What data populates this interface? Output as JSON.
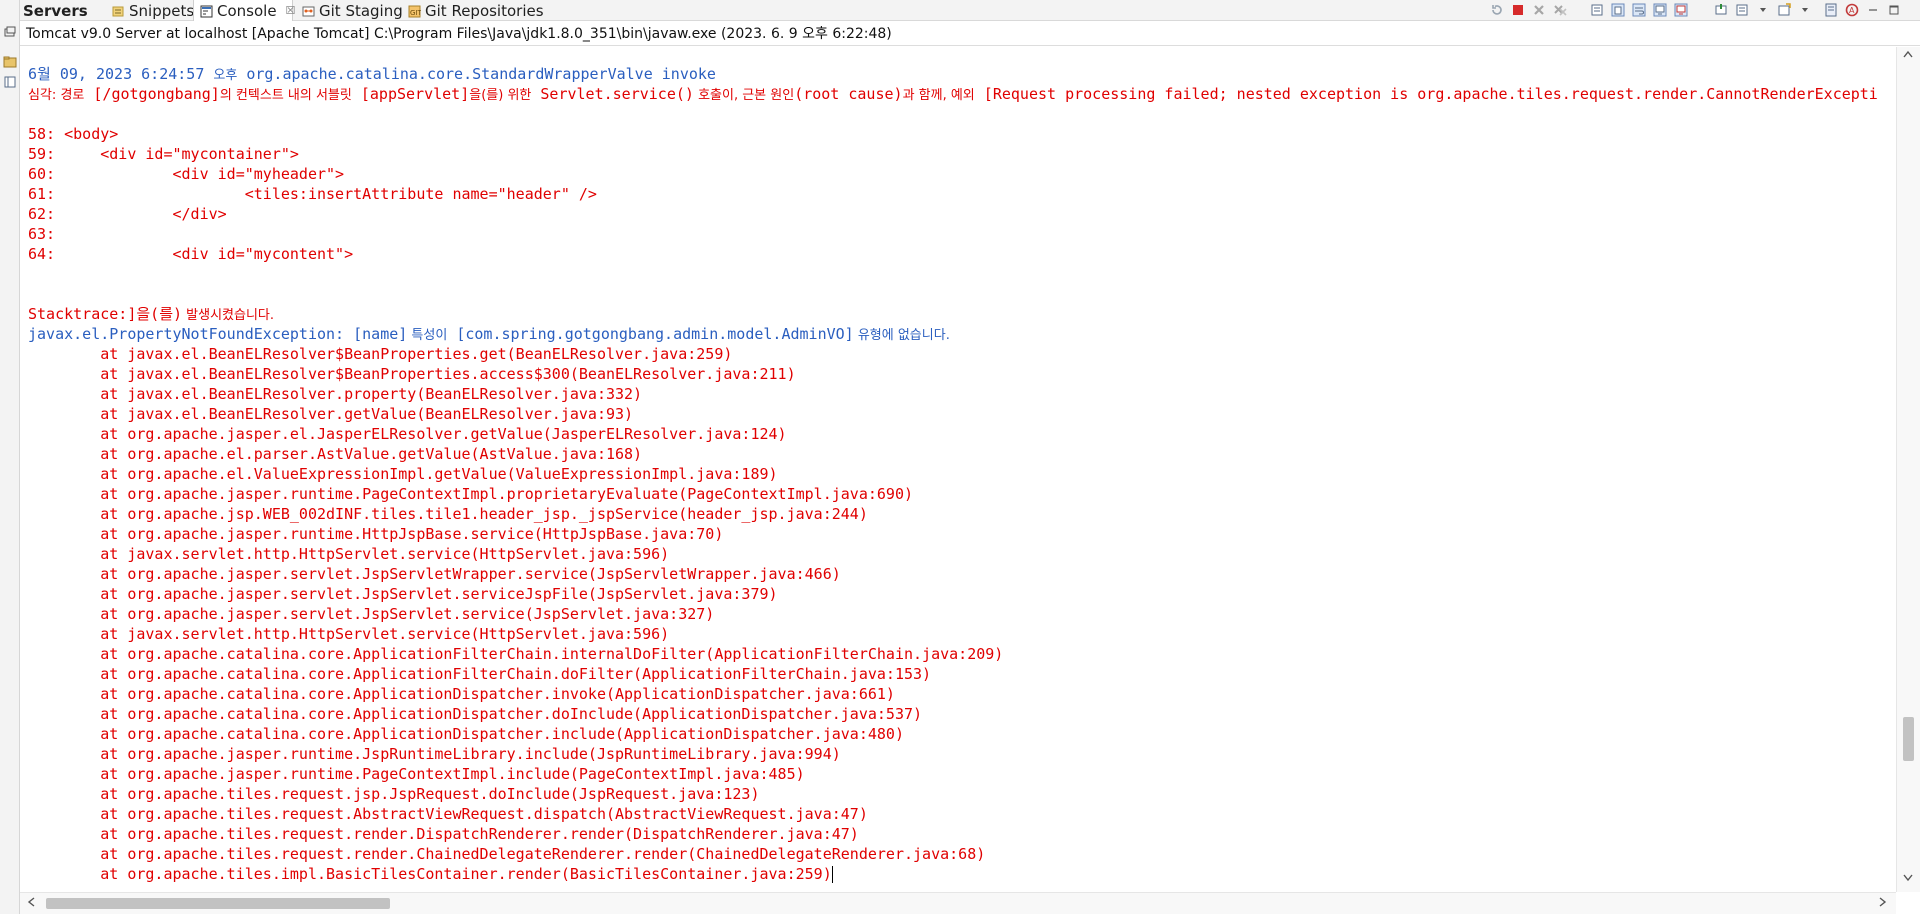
{
  "tabs": [
    {
      "label": "Servers",
      "icon": "servers-icon",
      "active": true
    },
    {
      "label": "Snippets",
      "icon": "snippets-icon"
    },
    {
      "label": "Console",
      "icon": "console-icon",
      "selected": true,
      "close": "☒"
    },
    {
      "label": "Git Staging",
      "icon": "git-staging-icon"
    },
    {
      "label": "Git Repositories",
      "icon": "git-repositories-icon"
    }
  ],
  "console_header": "Tomcat v9.0 Server at localhost [Apache Tomcat] C:\\Program Files\\Java\\jdk1.8.0_351\\bin\\javaw.exe  (2023. 6. 9 오후 6:22:48)",
  "log_header": {
    "date": "6월 09, 2023 6:24:57 ",
    "ampm": "오후",
    "source": " org.apache.catalina.core.StandardWrapperValve invoke"
  },
  "severe": {
    "level": "심각:",
    "t1": " 경로",
    "c1": " [/gotgongbang]",
    "t2": "의 컨텍스트 내의 서블릿",
    "c2": " [appServlet]",
    "t3": "을(를) 위한",
    "c3": " Servlet.service()",
    "t4": " 호출이, 근본 원인",
    "c4": "(root cause)",
    "t5": "과 함께, 예외",
    "c5": " [Request processing failed; nested exception is org.apache.tiles.request.render.CannotRenderExcepti"
  },
  "jsp_lines": [
    "58: <body>",
    "59:     <div id=\"mycontainer\">",
    "60:             <div id=\"myheader\">",
    "61:                     <tiles:insertAttribute name=\"header\" />",
    "62:             </div>",
    "63: ",
    "64:             <div id=\"mycontent\">"
  ],
  "stacktrace": {
    "code": "Stacktrace:]을(를)",
    "kr": " 발생시켰습니다."
  },
  "exception": {
    "c1": "javax.el.PropertyNotFoundException: [name]",
    "t1": " 특성이",
    "c2": " [com.spring.gotgongbang.admin.model.AdminVO]",
    "t2": " 유형에 없습니다."
  },
  "trace_lines": [
    "        at javax.el.BeanELResolver$BeanProperties.get(BeanELResolver.java:259)",
    "        at javax.el.BeanELResolver$BeanProperties.access$300(BeanELResolver.java:211)",
    "        at javax.el.BeanELResolver.property(BeanELResolver.java:332)",
    "        at javax.el.BeanELResolver.getValue(BeanELResolver.java:93)",
    "        at org.apache.jasper.el.JasperELResolver.getValue(JasperELResolver.java:124)",
    "        at org.apache.el.parser.AstValue.getValue(AstValue.java:168)",
    "        at org.apache.el.ValueExpressionImpl.getValue(ValueExpressionImpl.java:189)",
    "        at org.apache.jasper.runtime.PageContextImpl.proprietaryEvaluate(PageContextImpl.java:690)",
    "        at org.apache.jsp.WEB_002dINF.tiles.tile1.header_jsp._jspService(header_jsp.java:244)",
    "        at org.apache.jasper.runtime.HttpJspBase.service(HttpJspBase.java:70)",
    "        at javax.servlet.http.HttpServlet.service(HttpServlet.java:596)",
    "        at org.apache.jasper.servlet.JspServletWrapper.service(JspServletWrapper.java:466)",
    "        at org.apache.jasper.servlet.JspServlet.serviceJspFile(JspServlet.java:379)",
    "        at org.apache.jasper.servlet.JspServlet.service(JspServlet.java:327)",
    "        at javax.servlet.http.HttpServlet.service(HttpServlet.java:596)",
    "        at org.apache.catalina.core.ApplicationFilterChain.internalDoFilter(ApplicationFilterChain.java:209)",
    "        at org.apache.catalina.core.ApplicationFilterChain.doFilter(ApplicationFilterChain.java:153)",
    "        at org.apache.catalina.core.ApplicationDispatcher.invoke(ApplicationDispatcher.java:661)",
    "        at org.apache.catalina.core.ApplicationDispatcher.doInclude(ApplicationDispatcher.java:537)",
    "        at org.apache.catalina.core.ApplicationDispatcher.include(ApplicationDispatcher.java:480)",
    "        at org.apache.jasper.runtime.JspRuntimeLibrary.include(JspRuntimeLibrary.java:994)",
    "        at org.apache.jasper.runtime.PageContextImpl.include(PageContextImpl.java:485)",
    "        at org.apache.tiles.request.jsp.JspRequest.doInclude(JspRequest.java:123)",
    "        at org.apache.tiles.request.AbstractViewRequest.dispatch(AbstractViewRequest.java:47)",
    "        at org.apache.tiles.request.render.DispatchRenderer.render(DispatchRenderer.java:47)",
    "        at org.apache.tiles.request.render.ChainedDelegateRenderer.render(ChainedDelegateRenderer.java:68)",
    "        at org.apache.tiles.impl.BasicTilesContainer.render(BasicTilesContainer.java:259)"
  ],
  "colors": {
    "error_text": "#e00000",
    "info_text": "#2a5ebf",
    "background": "#ffffff"
  }
}
